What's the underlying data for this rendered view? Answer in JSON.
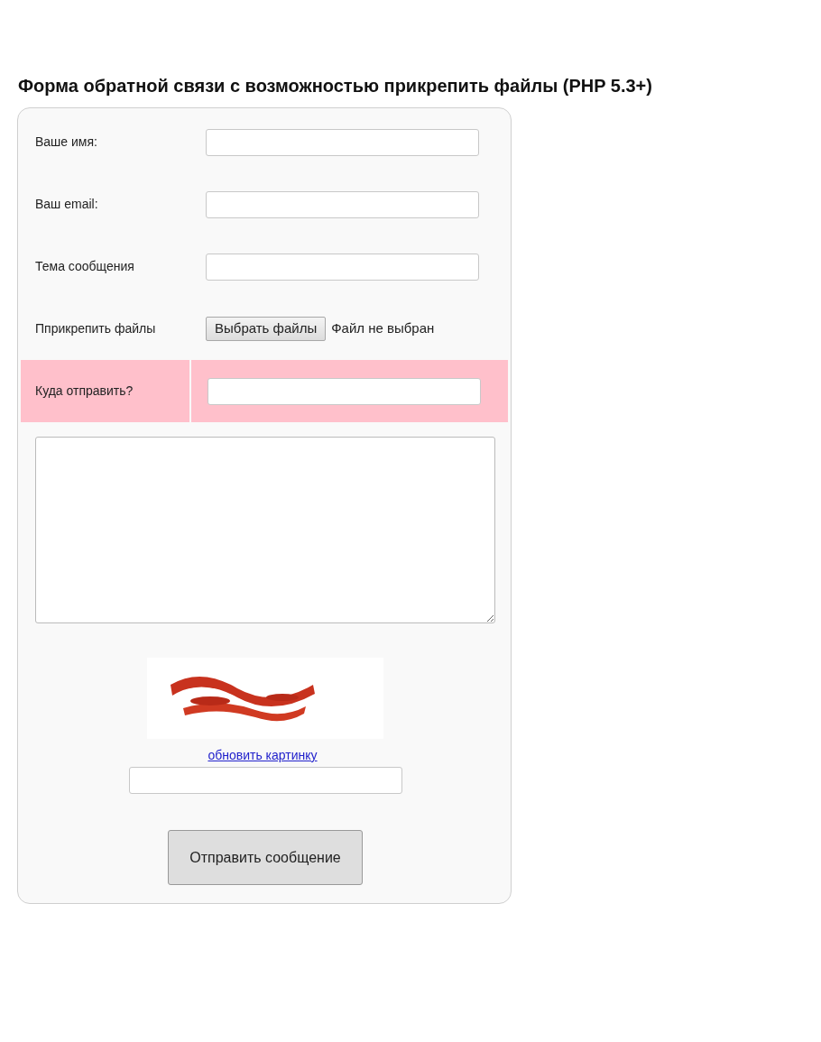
{
  "title": "Форма обратной связи с возможностью прикрепить файлы (PHP 5.3+)",
  "fields": [
    {
      "kind": "text",
      "label": "Ваше имя:",
      "highlighted": false
    },
    {
      "kind": "text",
      "label": "Ваш email:",
      "highlighted": false
    },
    {
      "kind": "text",
      "label": "Тема сообщения",
      "highlighted": false
    },
    {
      "kind": "file",
      "label": "Пприкрепить файлы",
      "button": "Выбрать файлы",
      "status": "Файл не выбран",
      "highlighted": false
    },
    {
      "kind": "text",
      "label": "Куда отправить?",
      "highlighted": true
    }
  ],
  "captcha": {
    "refresh_link": "обновить картинку"
  },
  "submit": "Отправить сообщение"
}
